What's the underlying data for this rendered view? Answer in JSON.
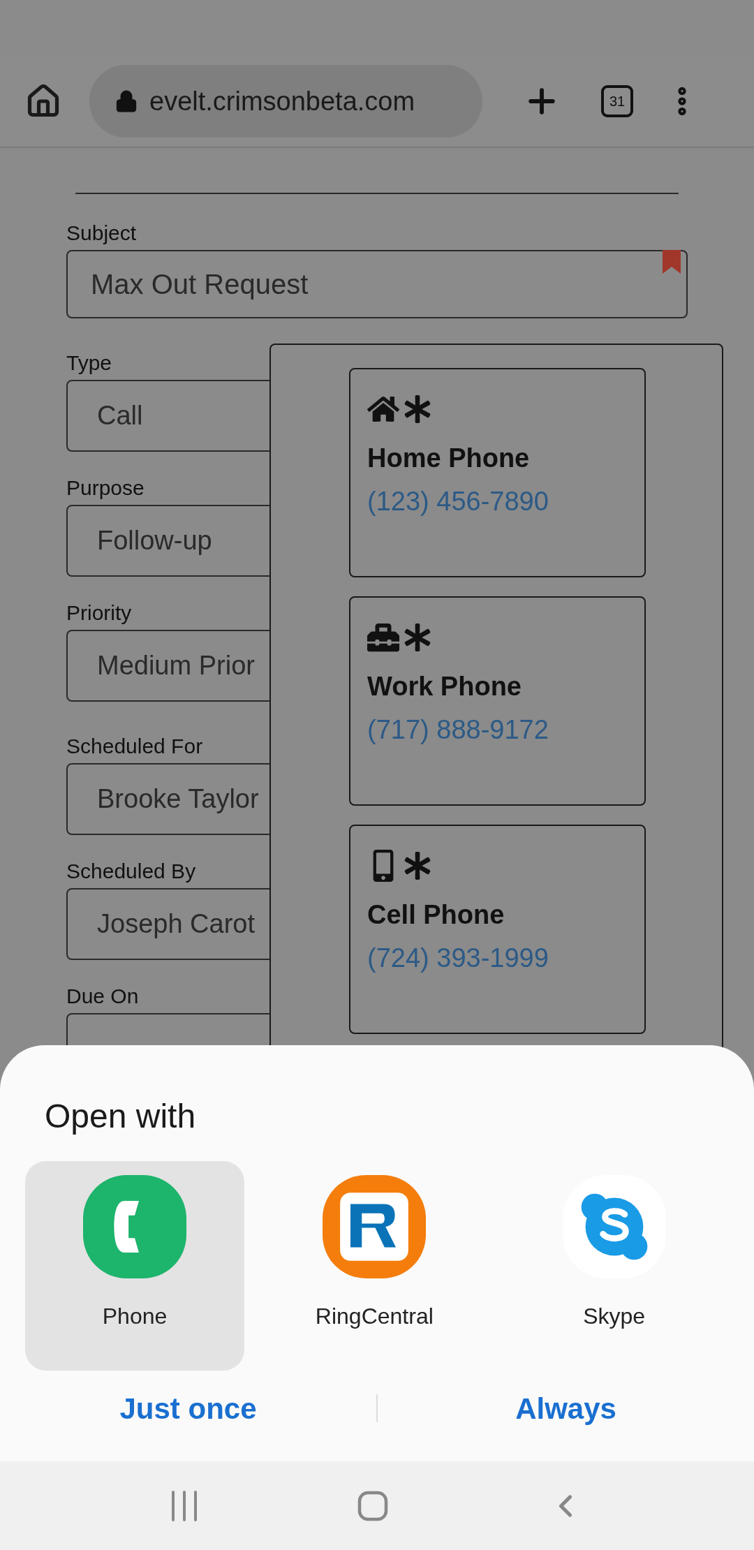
{
  "browser": {
    "url": "evelt.crimsonbeta.com",
    "tab_count": "31"
  },
  "form": {
    "subject": {
      "label": "Subject",
      "value": "Max Out Request",
      "required": true
    },
    "fields": [
      {
        "label": "Type",
        "value": "Call"
      },
      {
        "label": "Purpose",
        "value": "Follow-up"
      },
      {
        "label": "Priority",
        "value": "Medium Prior"
      },
      {
        "label": "Scheduled For",
        "value": "Brooke Taylor"
      },
      {
        "label": "Scheduled By",
        "value": "Joseph Carot"
      },
      {
        "label": "Due On"
      }
    ]
  },
  "phone_popup": {
    "numbers": [
      {
        "kind": "home",
        "label": "Home Phone",
        "number": "(123) 456-7890",
        "required": true
      },
      {
        "kind": "work",
        "label": "Work Phone",
        "number": "(717) 888-9172",
        "required": true
      },
      {
        "kind": "cell",
        "label": "Cell Phone",
        "number": "(724) 393-1999",
        "required": true
      }
    ]
  },
  "open_with": {
    "title": "Open with",
    "apps": [
      {
        "kind": "phone",
        "name": "Phone",
        "selected": true
      },
      {
        "kind": "ringcentral",
        "name": "RingCentral",
        "selected": false
      },
      {
        "kind": "skype",
        "name": "Skype",
        "selected": false
      }
    ],
    "buttons": [
      "Just once",
      "Always"
    ]
  }
}
